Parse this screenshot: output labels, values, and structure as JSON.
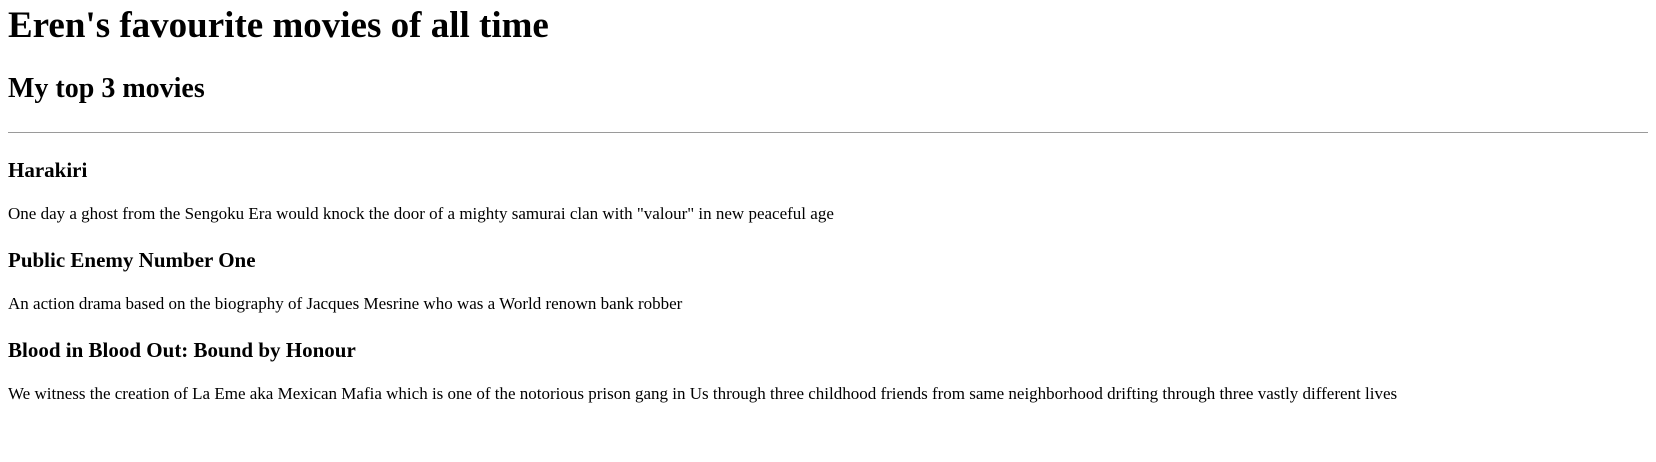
{
  "page": {
    "title": "Eren's favourite movies of all time",
    "subtitle": "My top 3 movies"
  },
  "movies": [
    {
      "title": "Harakiri",
      "description": "One day a ghost from the Sengoku Era would knock the door of a mighty samurai clan with \"valour\" in new peaceful age"
    },
    {
      "title": "Public Enemy Number One",
      "description": "An action drama based on the biography of Jacques Mesrine who was a World renown bank robber"
    },
    {
      "title": "Blood in Blood Out: Bound by Honour",
      "description": "We witness the creation of La Eme aka Mexican Mafia which is one of the notorious prison gang in Us through three childhood friends from same neighborhood drifting through three vastly different lives"
    }
  ]
}
